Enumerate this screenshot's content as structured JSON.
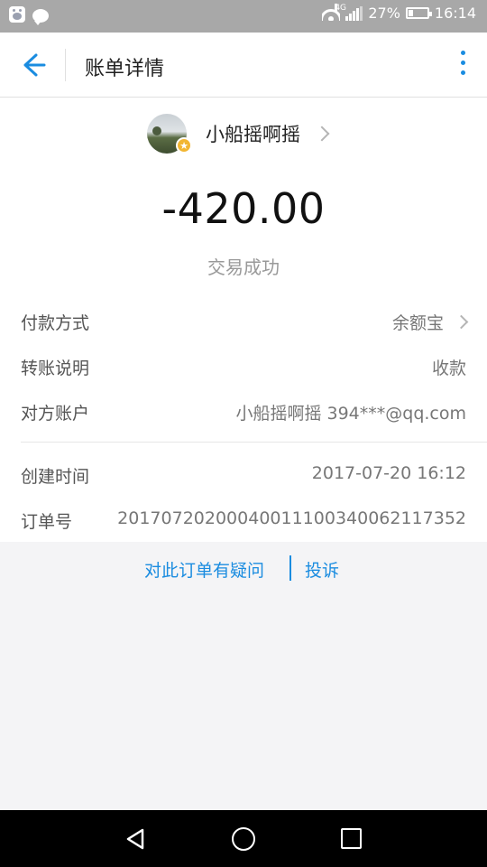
{
  "status_bar": {
    "network_type": "4G",
    "battery": "27%",
    "battery_level": 0.27,
    "time": "16:14",
    "icons": [
      "baidu-icon",
      "chat-icon",
      "wifi-icon",
      "signal-icon",
      "battery-icon"
    ]
  },
  "header": {
    "title": "账单详情",
    "back_icon": "arrow-left-icon",
    "more_icon": "more-vertical-icon",
    "accent_color": "#1a8ce0"
  },
  "counterparty": {
    "name": "小船摇啊摇",
    "badge_icon": "star-badge-icon"
  },
  "transaction": {
    "amount": "-420.00",
    "status": "交易成功"
  },
  "details": [
    {
      "label": "付款方式",
      "value": "余额宝"
    },
    {
      "label": "转账说明",
      "value": "收款"
    },
    {
      "label": "对方账户",
      "value": "小船摇啊摇 394***@qq.com"
    },
    {
      "label": "创建时间",
      "value": "2017-07-20 16:12"
    },
    {
      "label": "订单号",
      "value": "20170720200040011100340062117352"
    }
  ],
  "footer": {
    "question_link": "对此订单有疑问",
    "complaint_link": "投诉"
  },
  "nav": {
    "icons": [
      "nav-back-icon",
      "nav-home-icon",
      "nav-recent-icon"
    ]
  }
}
